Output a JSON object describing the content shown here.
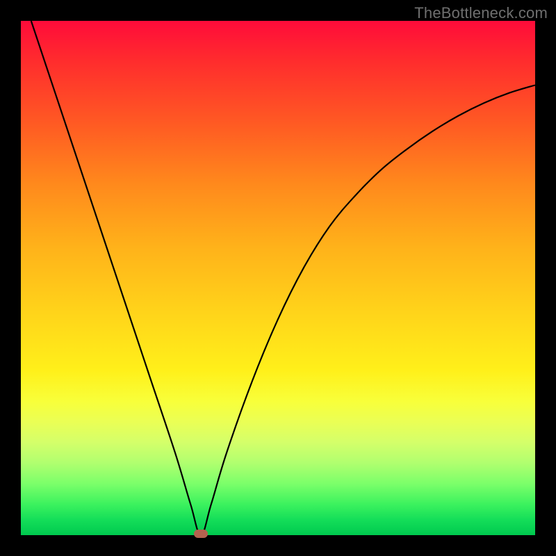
{
  "watermark": "TheBottleneck.com",
  "chart_data": {
    "type": "line",
    "title": "",
    "xlabel": "",
    "ylabel": "",
    "xlim": [
      0,
      100
    ],
    "ylim": [
      0,
      100
    ],
    "grid": false,
    "series": [
      {
        "name": "bottleneck-curve",
        "x": [
          2,
          5,
          10,
          15,
          20,
          25,
          30,
          33,
          35,
          37,
          40,
          45,
          50,
          55,
          60,
          65,
          70,
          75,
          80,
          85,
          90,
          95,
          100
        ],
        "values": [
          100,
          91,
          76,
          61,
          46,
          31,
          16,
          6,
          0,
          6,
          16,
          30,
          42,
          52,
          60,
          66,
          71,
          75,
          78.5,
          81.5,
          84,
          86,
          87.5
        ]
      }
    ],
    "annotations": [
      {
        "type": "marker",
        "name": "minimum-point",
        "x": 35,
        "y": 0,
        "color": "#b4624f"
      }
    ],
    "background_gradient": {
      "top": "#ff0b3a",
      "bottom": "#00c94f",
      "meaning": "bottleneck severity (red=high, green=low)"
    }
  }
}
